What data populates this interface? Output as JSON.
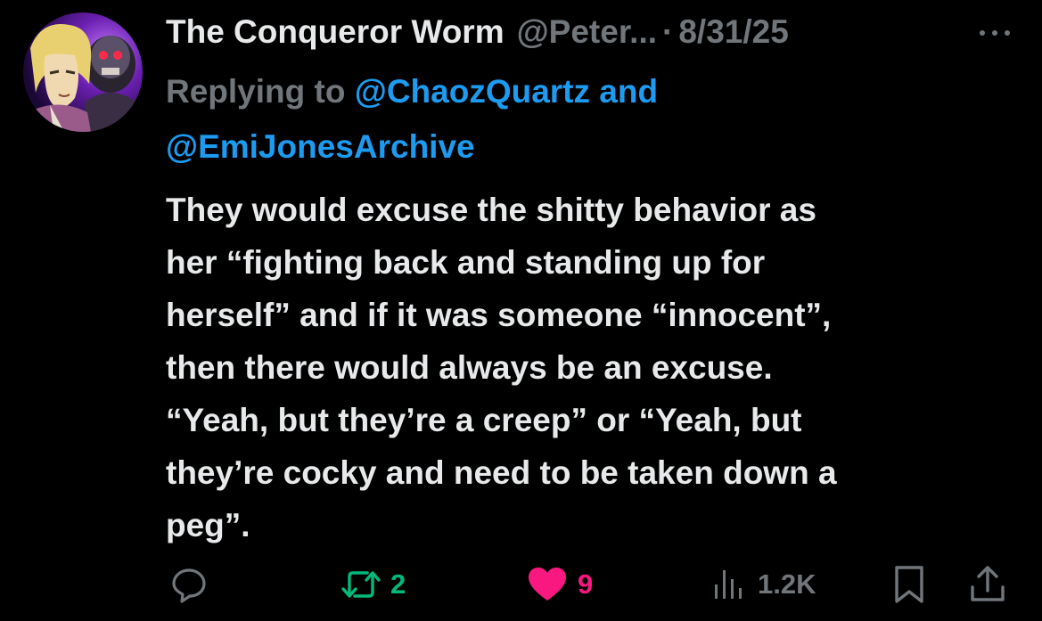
{
  "tweet": {
    "display_name": "The Conqueror Worm",
    "handle": "@Peter...",
    "separator": "·",
    "date": "8/31/25",
    "more_label": "···",
    "replying_to_prefix": "Replying to",
    "mentions": [
      "@ChaozQuartz",
      "@EmiJonesArchive"
    ],
    "mention_joiner": "and",
    "body_lines": [
      "They would excuse the shitty behavior as",
      "her “fighting back and standing up for",
      "herself” and if it was someone “innocent”,",
      "then there would always be an excuse.",
      "“Yeah, but they’re a creep” or “Yeah, but",
      "they’re cocky and need to be taken down a",
      "peg”."
    ]
  },
  "actions": {
    "reply_icon": "reply-bubble-icon",
    "retweet_icon": "retweet-icon",
    "retweet_count": "2",
    "like_icon": "heart-icon",
    "like_count": "9",
    "views_icon": "views-bars-icon",
    "views_count": "1.2K",
    "bookmark_icon": "bookmark-icon",
    "share_icon": "share-icon"
  },
  "colors": {
    "background": "#000000",
    "text_primary": "#e7e9ea",
    "text_secondary": "#71767b",
    "link": "#1d9bf0",
    "retweet_active": "#00ba7c",
    "like_active": "#f91880"
  }
}
